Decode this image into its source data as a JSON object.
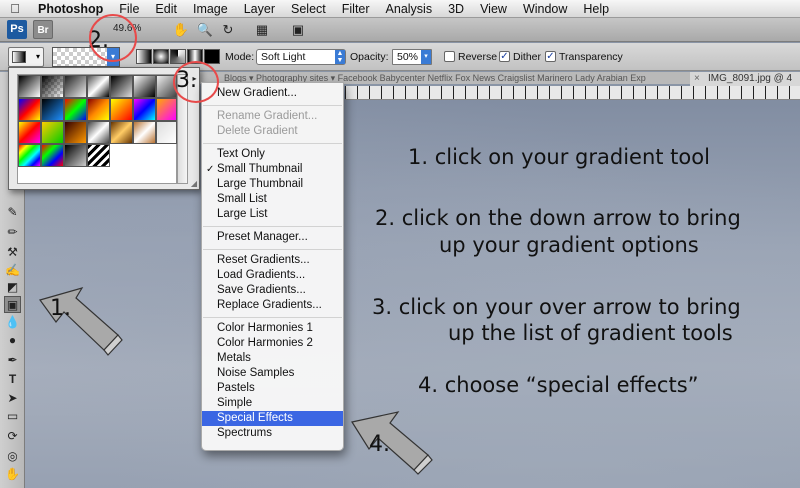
{
  "menubar": {
    "apple": "",
    "items": [
      "Photoshop",
      "File",
      "Edit",
      "Image",
      "Layer",
      "Select",
      "Filter",
      "Analysis",
      "3D",
      "View",
      "Window",
      "Help"
    ]
  },
  "appbar": {
    "ps_logo": "Ps",
    "br_logo": "Br",
    "zoom": "49.6%"
  },
  "options": {
    "mode_label": "Mode:",
    "mode_value": "Soft Light",
    "opacity_label": "Opacity:",
    "opacity_value": "50%",
    "reverse_label": "Reverse",
    "dither_label": "Dither",
    "transparency_label": "Transparency",
    "reverse_checked": false,
    "dither_checked": true,
    "transparency_checked": true
  },
  "tabs": {
    "bookmarks": "Blogs ▾   Photography sites ▾   Facebook   Babycenter   Netflix   Fox News   Craigslist   Marinero   Lady Arabian   Exp",
    "document": "IMG_8091.jpg @ 4"
  },
  "menu": {
    "items": [
      {
        "label": "New Gradient...",
        "state": "enabled"
      },
      {
        "sep": true
      },
      {
        "label": "Rename Gradient...",
        "state": "disabled"
      },
      {
        "label": "Delete Gradient",
        "state": "disabled"
      },
      {
        "sep": true
      },
      {
        "label": "Text Only",
        "state": "enabled"
      },
      {
        "label": "Small Thumbnail",
        "state": "checked"
      },
      {
        "label": "Large Thumbnail",
        "state": "enabled"
      },
      {
        "label": "Small List",
        "state": "enabled"
      },
      {
        "label": "Large List",
        "state": "enabled"
      },
      {
        "sep": true
      },
      {
        "label": "Preset Manager...",
        "state": "enabled"
      },
      {
        "sep": true
      },
      {
        "label": "Reset Gradients...",
        "state": "enabled"
      },
      {
        "label": "Load Gradients...",
        "state": "enabled"
      },
      {
        "label": "Save Gradients...",
        "state": "enabled"
      },
      {
        "label": "Replace Gradients...",
        "state": "enabled"
      },
      {
        "sep": true
      },
      {
        "label": "Color Harmonies 1",
        "state": "enabled"
      },
      {
        "label": "Color Harmonies 2",
        "state": "enabled"
      },
      {
        "label": "Metals",
        "state": "enabled"
      },
      {
        "label": "Noise Samples",
        "state": "enabled"
      },
      {
        "label": "Pastels",
        "state": "enabled"
      },
      {
        "label": "Simple",
        "state": "enabled"
      },
      {
        "label": "Special Effects",
        "state": "highlighted"
      },
      {
        "label": "Spectrums",
        "state": "enabled"
      }
    ]
  },
  "instructions": [
    "1. click on your gradient tool",
    "2. click on the down arrow to bring",
    "up your gradient options",
    "3. click on your over arrow to bring",
    "up the list of gradient tools",
    "4. choose “special effects”"
  ],
  "labels": {
    "step1": "1.",
    "step2": "2.",
    "step3": "3.",
    "step4": "4."
  },
  "colors": {
    "highlight": "#3b66e3",
    "annotation_circle": "#e84a4a"
  }
}
